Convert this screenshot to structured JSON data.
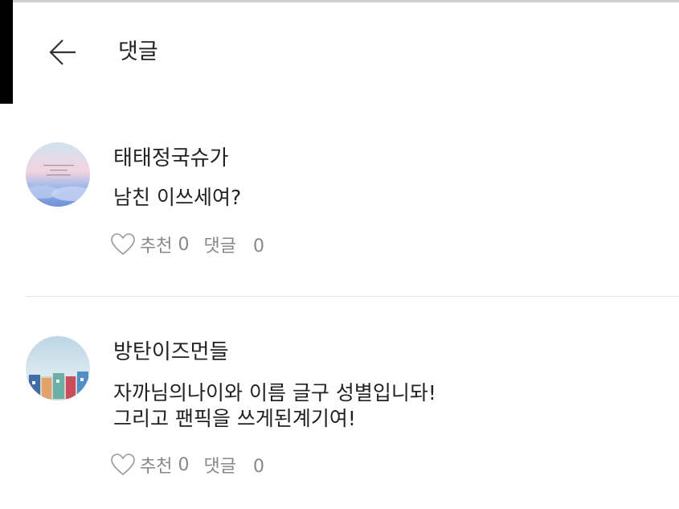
{
  "header": {
    "title": "댓글",
    "back_icon": "arrow-left-icon"
  },
  "comments": [
    {
      "username": "태태정국슈가",
      "lines": [
        "남친 이쓰세여?"
      ],
      "like_label": "추천",
      "like_count": "0",
      "reply_label": "댓글",
      "reply_count": "0"
    },
    {
      "username": "방탄이즈먼들",
      "lines": [
        "자까님의나이와 이름 글구 성별입니돠!",
        "그리고 팬픽을 쓰게된계기여!"
      ],
      "like_label": "추천",
      "like_count": "0",
      "reply_label": "댓글",
      "reply_count": "0"
    }
  ],
  "colors": {
    "text": "#222222",
    "muted": "#888888",
    "divider": "#e3e3e3"
  }
}
